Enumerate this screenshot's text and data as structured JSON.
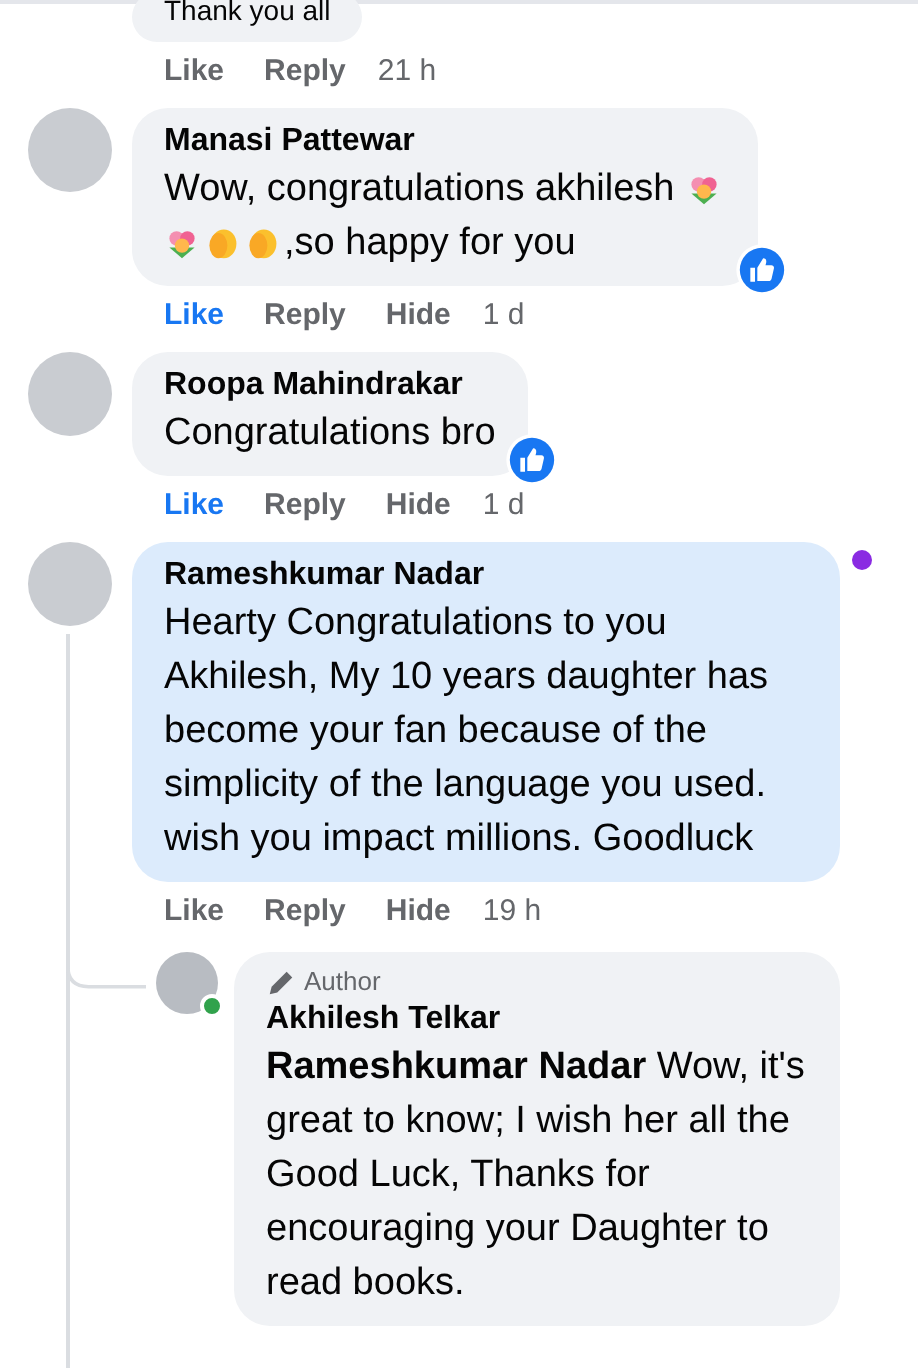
{
  "previous_comment": {
    "text": "Thank you all",
    "actions": [
      {
        "label": "Like",
        "selected": false
      },
      {
        "label": "Reply"
      }
    ],
    "time": "21 h"
  },
  "comments": [
    {
      "name": "Manasi Pattewar",
      "highlighted": false,
      "unread": false,
      "reacted": true,
      "thread": false,
      "parts": [
        {
          "kind": "text",
          "text": "Wow, congratulations akhilesh "
        },
        {
          "kind": "flower"
        },
        {
          "kind": "break"
        },
        {
          "kind": "flower"
        },
        {
          "kind": "clap"
        },
        {
          "kind": "clap"
        },
        {
          "kind": "text",
          "text": ",so happy for you"
        }
      ],
      "actions": [
        {
          "label": "Like",
          "selected": true
        },
        {
          "label": "Reply"
        },
        {
          "label": "Hide"
        }
      ],
      "time": "1 d"
    },
    {
      "name": "Roopa Mahindrakar",
      "highlighted": false,
      "unread": false,
      "reacted": true,
      "thread": false,
      "parts": [
        {
          "kind": "text",
          "text": "Congratulations bro"
        }
      ],
      "actions": [
        {
          "label": "Like",
          "selected": true
        },
        {
          "label": "Reply"
        },
        {
          "label": "Hide"
        }
      ],
      "time": "1 d"
    },
    {
      "name": "Rameshkumar Nadar",
      "highlighted": true,
      "unread": true,
      "reacted": false,
      "thread": true,
      "parts": [
        {
          "kind": "text",
          "text": "Hearty Congratulations to you Akhilesh, My 10 years daughter has become your fan because of the simplicity of the language you used. wish you impact millions. Goodluck"
        }
      ],
      "actions": [
        {
          "label": "Like",
          "selected": false
        },
        {
          "label": "Reply"
        },
        {
          "label": "Hide"
        }
      ],
      "time": "19 h"
    }
  ],
  "reply": {
    "badge": "Author",
    "name": "Akhilesh Telkar",
    "online": true,
    "text": "**Rameshkumar Nadar** Wow, it's great to know; I wish her all the Good Luck, Thanks for encouraging your Daughter to read books."
  }
}
